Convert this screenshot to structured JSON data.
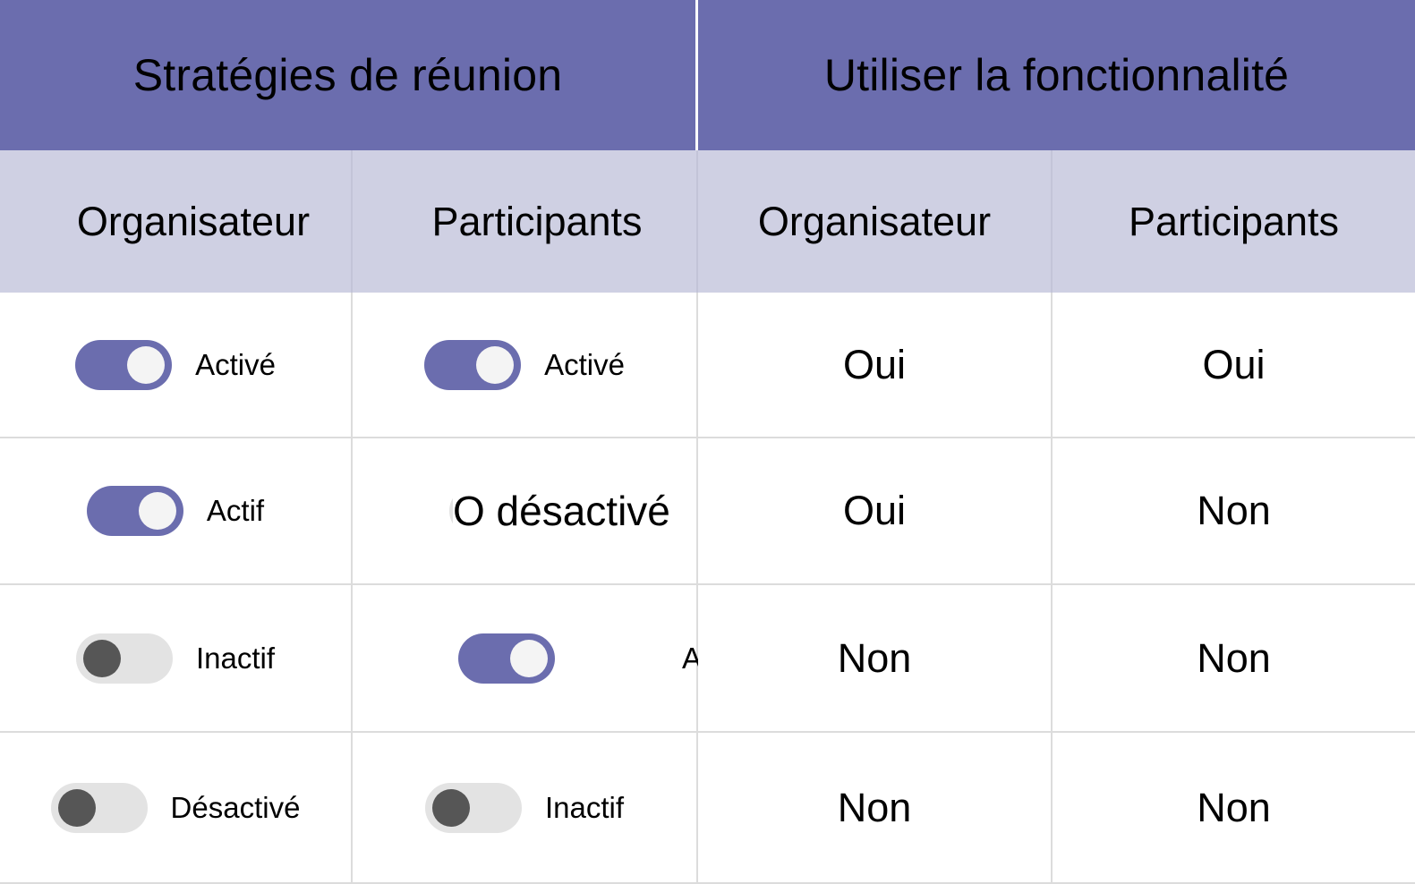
{
  "table": {
    "group_headers": [
      {
        "label": "Stratégies de réunion"
      },
      {
        "label": "Utiliser la fonctionnalité"
      }
    ],
    "column_headers": [
      {
        "label": "Organisateur"
      },
      {
        "label": "Participants"
      },
      {
        "label": "Organisateur"
      },
      {
        "label": "Participants"
      }
    ],
    "rows": [
      {
        "organiser_policy": {
          "state": "on",
          "label": "Activé"
        },
        "participant_policy": {
          "state": "on",
          "label": "Activé"
        },
        "organiser_result": "Oui",
        "participant_result": "Oui"
      },
      {
        "organiser_policy": {
          "state": "on",
          "label": "Actif"
        },
        "participant_policy": {
          "state": "off",
          "label": "O désactivé"
        },
        "organiser_result": "Oui",
        "participant_result": "Non"
      },
      {
        "organiser_policy": {
          "state": "off",
          "label": "Inactif"
        },
        "participant_policy": {
          "state": "on",
          "label": "Actif"
        },
        "organiser_result": "Non",
        "participant_result": "Non"
      },
      {
        "organiser_policy": {
          "state": "off",
          "label": "Désactivé"
        },
        "participant_policy": {
          "state": "off",
          "label": "Inactif"
        },
        "organiser_result": "Non",
        "participant_result": "Non"
      }
    ]
  },
  "colors": {
    "header_purple": "#6b6dae",
    "subheader_lavender": "#cfd0e3",
    "toggle_on": "#6b6dae",
    "toggle_off_track": "#e3e3e3",
    "toggle_off_knob": "#565656",
    "toggle_on_knob": "#f4f4f4",
    "grid_line": "#dcdcdc"
  }
}
